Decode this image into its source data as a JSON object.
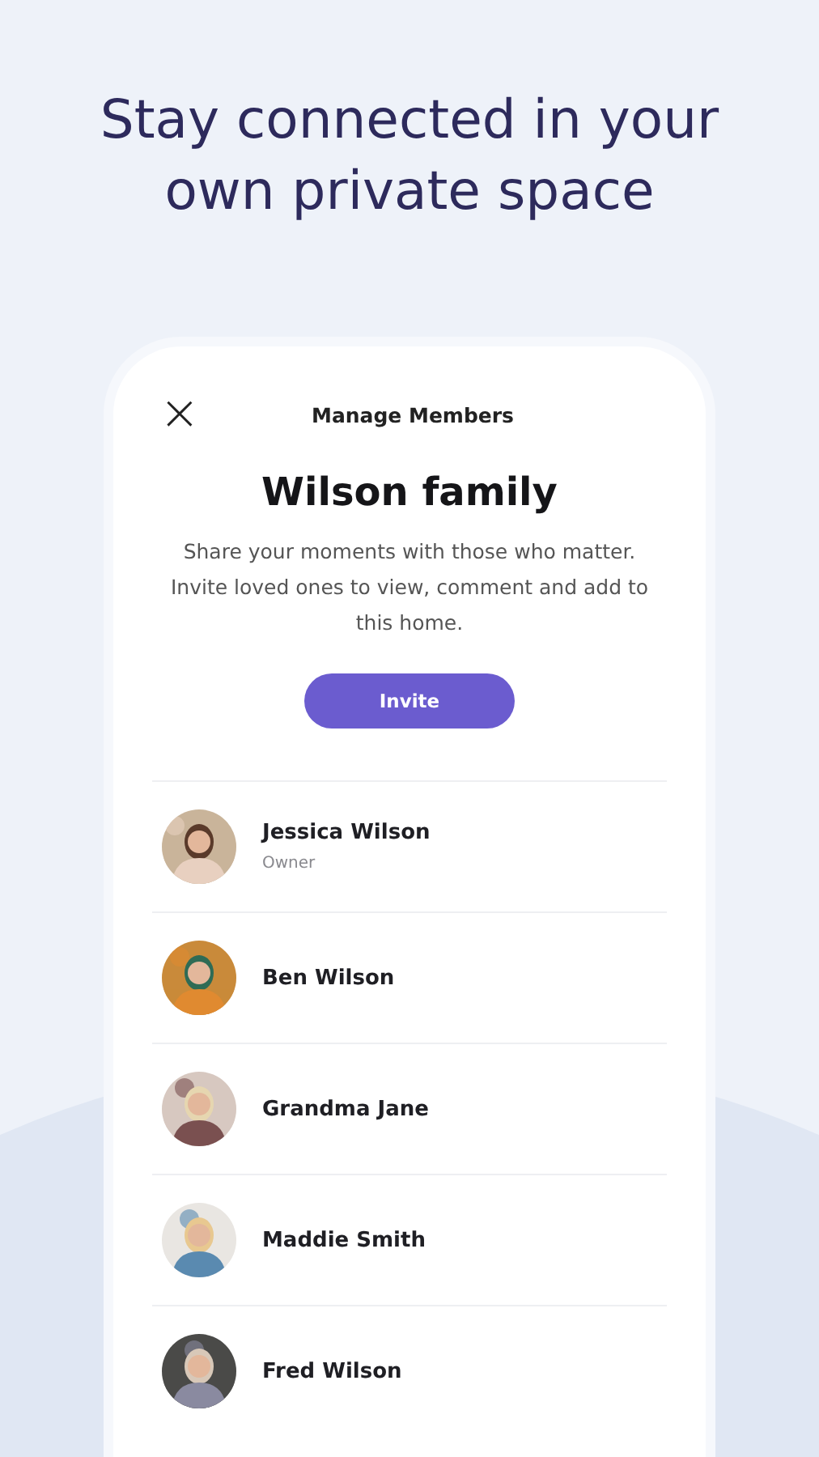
{
  "headline": "Stay connected in your own private space",
  "header": {
    "close": "×",
    "title": "Manage Members"
  },
  "group": {
    "name": "Wilson family",
    "description": "Share your moments with those who matter. Invite loved ones to view, comment and add to this home."
  },
  "invite_button": "Invite",
  "members": [
    {
      "name": "Jessica Wilson",
      "role": "Owner"
    },
    {
      "name": "Ben Wilson"
    },
    {
      "name": "Grandma Jane"
    },
    {
      "name": "Maddie Smith"
    },
    {
      "name": "Fred Wilson"
    }
  ]
}
